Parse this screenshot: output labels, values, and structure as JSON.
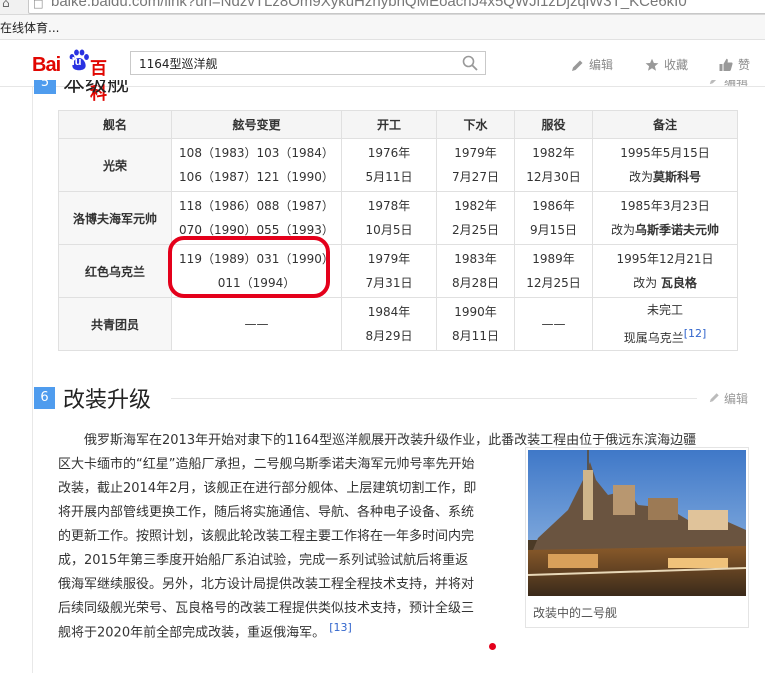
{
  "browser": {
    "url": "baike.baidu.com/link?url=NdzvTLz8Om9XykuHzhybnQMEoachJ4x5QWJl1zDjzqiW3T_KCe6kI0",
    "bookmark": "在线体育..."
  },
  "header": {
    "logo_bai": "Bai",
    "logo_du": "du",
    "logo_baike": "百科",
    "search_value": "1164型巡洋舰",
    "actions": {
      "edit": "编辑",
      "favorite": "收藏",
      "like": "赞"
    }
  },
  "prev_section": {
    "number": "5",
    "title": "本级舰",
    "edit": "编辑"
  },
  "table": {
    "headers": [
      "舰名",
      "舷号变更",
      "开工",
      "下水",
      "服役",
      "备注"
    ],
    "rows": [
      {
        "name": "光荣",
        "hull": [
          "108（1983）103（1984）",
          "106（1987）121（1990）"
        ],
        "laid": [
          "1976年",
          "5月11日"
        ],
        "launched": [
          "1979年",
          "7月27日"
        ],
        "commissioned": [
          "1982年",
          "12月30日"
        ],
        "note1": "1995年5月15日",
        "note2_prefix": "改为",
        "note2_bold": "莫斯科号",
        "note_ref": ""
      },
      {
        "name": "洛博夫海军元帅",
        "hull": [
          "118（1986）088（1987）",
          "070（1990）055（1993）"
        ],
        "laid": [
          "1978年",
          "10月5日"
        ],
        "launched": [
          "1982年",
          "2月25日"
        ],
        "commissioned": [
          "1986年",
          "9月15日"
        ],
        "note1": "1985年3月23日",
        "note2_prefix": "改为",
        "note2_bold": "乌斯季诺夫元帅",
        "note_ref": ""
      },
      {
        "name": "红色乌克兰",
        "hull": [
          "119（1989）031（1990）",
          "011（1994）"
        ],
        "laid": [
          "1979年",
          "7月31日"
        ],
        "launched": [
          "1983年",
          "8月28日"
        ],
        "commissioned": [
          "1989年",
          "12月25日"
        ],
        "note1": "1995年12月21日",
        "note2_prefix": "改为 ",
        "note2_bold": "瓦良格",
        "note_ref": ""
      },
      {
        "name": "共青团员",
        "hull": [
          "——"
        ],
        "laid": [
          "1984年",
          "8月29日"
        ],
        "launched": [
          "1990年",
          "8月11日"
        ],
        "commissioned": [
          "——"
        ],
        "note1": "未完工",
        "note2_prefix": "现属乌克兰",
        "note2_bold": "",
        "note_ref": "[12]"
      }
    ]
  },
  "section6": {
    "number": "6",
    "title": "改装升级",
    "edit": "编辑",
    "lines": [
      "俄罗斯海军在2013年开始对隶下的1164型巡洋舰展开改装升级作业，此番改装工程由位于俄远东滨海边疆",
      "区大卡缅市的“红星”造船厂承担，二号舰乌斯季诺夫海军元帅号率先开始",
      "改装，截止2014年2月，该舰正在进行部分舰体、上层建筑切割工作，即",
      "将开展内部管线更换工作，随后将实施通信、导航、各种电子设备、系统",
      "的更新工作。按照计划，该舰此轮改装工程主要工作将在一年多时间内完",
      "成，2015年第三季度开始船厂系泊试验，完成一系列试验试航后将重返",
      "俄海军继续服役。另外，北方设计局提供改装工程全程技术支持，并将对",
      "后续同级舰光荣号、瓦良格号的改装工程提供类似技术支持，预计全级三",
      "舰将于2020年前全部完成改装，重返俄海军。"
    ],
    "ref": "[13]",
    "figure_caption": "改装中的二号舰"
  }
}
